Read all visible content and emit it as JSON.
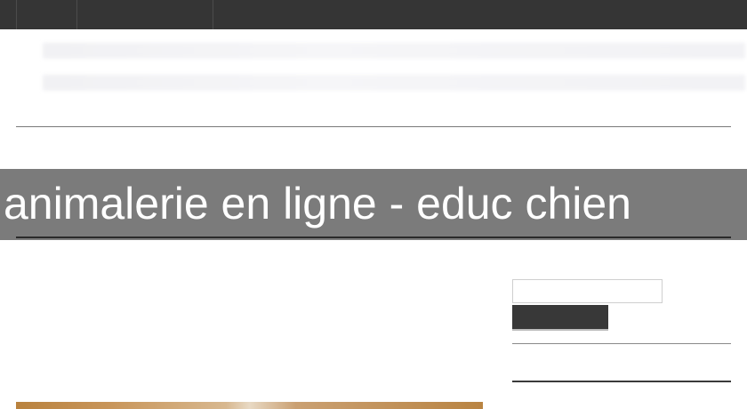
{
  "site": {
    "page_title": "animalerie en ligne - educ chien"
  },
  "top_nav": {
    "items": [
      "",
      "",
      ""
    ]
  },
  "sidebar": {
    "search": {
      "value": "",
      "placeholder": "",
      "button_label": ""
    }
  },
  "colors": {
    "top_bar": "#353535",
    "title_band": "#7b7b7b",
    "title_text": "#ffffff",
    "button": "#383838"
  }
}
